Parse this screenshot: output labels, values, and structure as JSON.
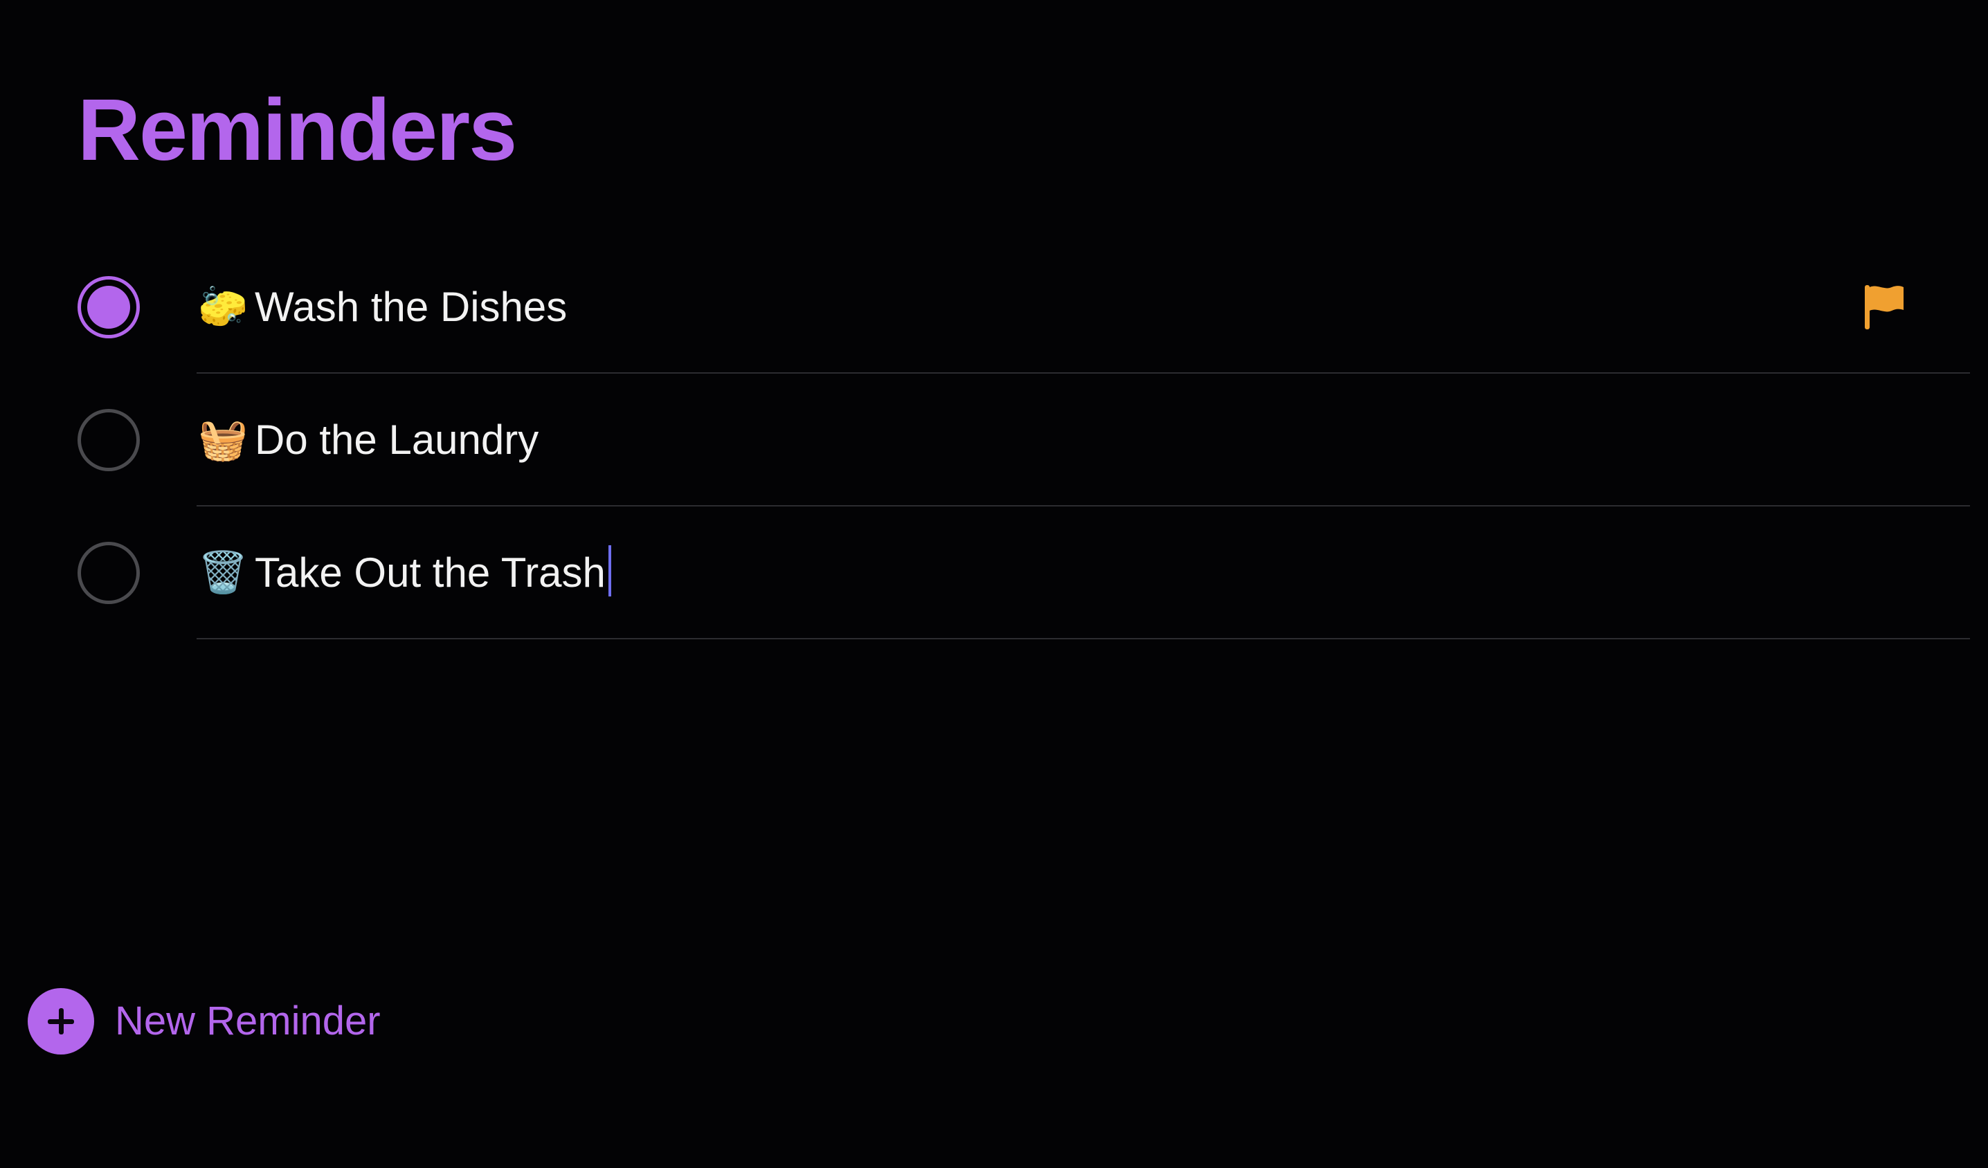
{
  "app": {
    "title": "Reminders",
    "accent_color": "#b366ec",
    "flag_color": "#f0a030"
  },
  "reminders": [
    {
      "emoji": "🧽",
      "emoji_name": "sponge-icon",
      "text": "Wash the Dishes",
      "completed": true,
      "flagged": true
    },
    {
      "emoji": "🧺",
      "emoji_name": "laundry-basket-icon",
      "text": "Do the Laundry",
      "completed": false,
      "flagged": false
    },
    {
      "emoji": "🗑️",
      "emoji_name": "wastebasket-icon",
      "text": "Take Out the Trash",
      "completed": false,
      "flagged": false,
      "editing": true
    }
  ],
  "footer": {
    "new_reminder_label": "New Reminder",
    "new_reminder_icon": "plus-circle-icon"
  }
}
